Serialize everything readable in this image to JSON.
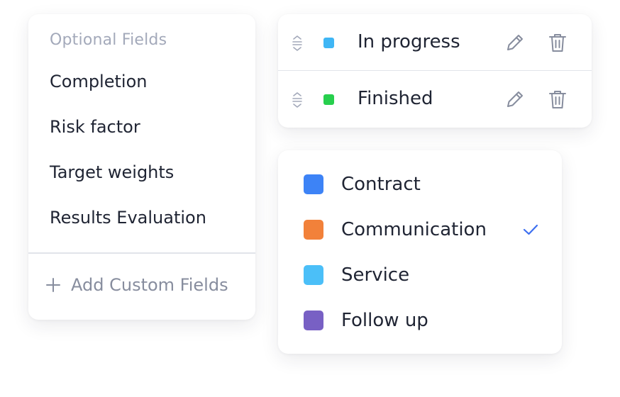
{
  "optional_fields": {
    "title": "Optional Fields",
    "items": [
      {
        "label": "Completion"
      },
      {
        "label": "Risk factor"
      },
      {
        "label": "Target weights"
      },
      {
        "label": "Results Evaluation"
      }
    ],
    "add_custom_label": "Add Custom Fields",
    "add_icon": "plus-icon"
  },
  "statuses": {
    "items": [
      {
        "label": "In progress",
        "color": "#3fb6f5"
      },
      {
        "label": "Finished",
        "color": "#27cf4d"
      }
    ],
    "drag_icon": "drag-handle-icon",
    "edit_icon": "pencil-icon",
    "delete_icon": "trash-icon"
  },
  "categories": {
    "items": [
      {
        "label": "Contract",
        "color": "#3d83f6",
        "selected": false
      },
      {
        "label": "Communication",
        "color": "#f2813a",
        "selected": true
      },
      {
        "label": "Service",
        "color": "#4bbff8",
        "selected": false
      },
      {
        "label": "Follow up",
        "color": "#7860c4",
        "selected": false
      }
    ],
    "check_icon": "checkmark-icon",
    "check_color": "#3d6ff0"
  }
}
